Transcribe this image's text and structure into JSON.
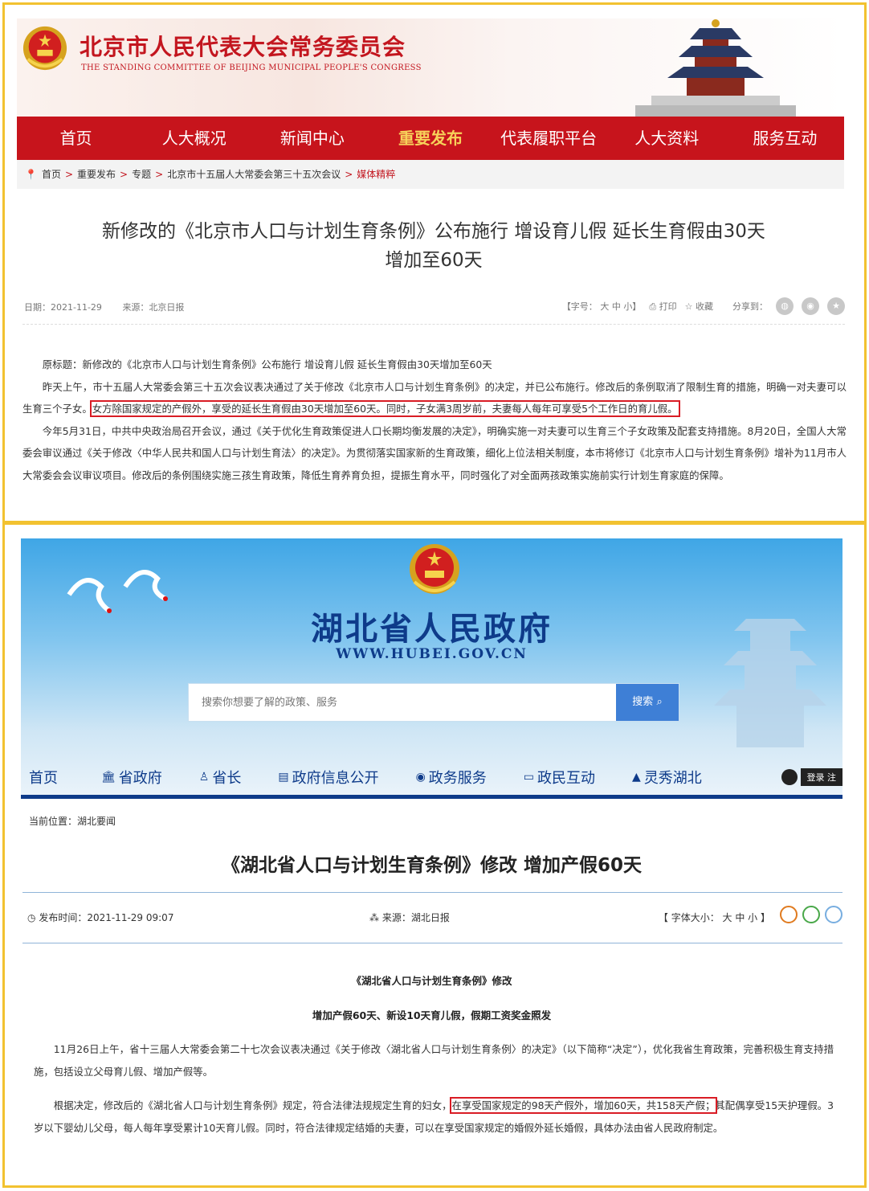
{
  "beijing": {
    "site_title": "北京市人民代表大会常务委员会",
    "site_subtitle": "THE STANDING COMMITTEE OF BEIJING MUNICIPAL PEOPLE'S CONGRESS",
    "nav": [
      "首页",
      "人大概况",
      "新闻中心",
      "重要发布",
      "代表履职平台",
      "人大资料",
      "服务互动"
    ],
    "nav_active": "重要发布",
    "breadcrumb": [
      "首页",
      "重要发布",
      "专题",
      "北京市十五届人大常委会第三十五次会议",
      "媒体精粹"
    ],
    "headline_line1": "新修改的《北京市人口与计划生育条例》公布施行 增设育儿假 延长生育假由30天",
    "headline_line2": "增加至60天",
    "date": "日期：2021-11-29",
    "source": "来源：北京日报",
    "font_size_label": "【字号：",
    "font_sizes": [
      "大",
      "中",
      "小】"
    ],
    "print": "打印",
    "favorite": "收藏",
    "share": "分享到：",
    "para1": "原标题：新修改的《北京市人口与计划生育条例》公布施行 增设育儿假 延长生育假由30天增加至60天",
    "para2_a": "昨天上午，市十五届人大常委会第三十五次会议表决通过了关于修改《北京市人口与计划生育条例》的决定，并已公布施行。修改后的条例取消了限制生育的措施，明确一对夫妻可以生育三个子女。",
    "para2_hl": "女方除国家规定的产假外，享受的延长生育假由30天增加至60天。同时，子女满3周岁前，夫妻每人每年可享受5个工作日的育儿假。",
    "para3": "今年5月31日，中共中央政治局召开会议，通过《关于优化生育政策促进人口长期均衡发展的决定》，明确实施一对夫妻可以生育三个子女政策及配套支持措施。8月20日，全国人大常委会审议通过《关于修改〈中华人民共和国人口与计划生育法〉的决定》。为贯彻落实国家新的生育政策，细化上位法相关制度，本市将修订《北京市人口与计划生育条例》增补为11月市人大常委会会议审议项目。修改后的条例围绕实施三孩生育政策，降低生育养育负担，提振生育水平，同时强化了对全面两孩政策实施前实行计划生育家庭的保障。"
  },
  "hubei": {
    "site_title": "湖北省人民政府",
    "site_url": "WWW.HUBEI.GOV.CN",
    "search_placeholder": "搜索你想要了解的政策、服务",
    "search_button": "搜索",
    "nav": [
      {
        "label": "首页",
        "icon": ""
      },
      {
        "label": "省政府",
        "icon": "🏛"
      },
      {
        "label": "省长",
        "icon": "♙"
      },
      {
        "label": "政府信息公开",
        "icon": "▤"
      },
      {
        "label": "政务服务",
        "icon": "◉"
      },
      {
        "label": "政民互动",
        "icon": "▭"
      },
      {
        "label": "灵秀湖北",
        "icon": "▲"
      }
    ],
    "login": "登录 注",
    "breadcrumb": "当前位置：湖北要闻",
    "headline": "《湖北省人口与计划生育条例》修改 增加产假60天",
    "publish_time": "发布时间：2021-11-29 09:07",
    "source": "来源：湖北日报",
    "font_size_label": "【 字体大小：",
    "font_sizes": "大 中 小 】",
    "sub1": "《湖北省人口与计划生育条例》修改",
    "sub2": "增加产假60天、新设10天育儿假，假期工资奖金照发",
    "para1": "11月26日上午，省十三届人大常委会第二十七次会议表决通过《关于修改〈湖北省人口与计划生育条例〉的决定》（以下简称“决定”），优化我省生育政策，完善积极生育支持措施，包括设立父母育儿假、增加产假等。",
    "para2_a": "根据决定，修改后的《湖北省人口与计划生育条例》规定，符合法律法规规定生育的妇女，",
    "para2_hl": "在享受国家规定的98天产假外，增加60天，共158天产假；",
    "para2_b": "其配偶享受15天护理假。3岁以下婴幼儿父母，每人每年享受累计10天育儿假。同时，符合法律规定结婚的夫妻，可以在享受国家规定的婚假外延长婚假，具体办法由省人民政府制定。"
  },
  "colors": {
    "beijing_red": "#c7141c",
    "hubei_blue": "#0e3b8a",
    "frame_yellow": "#f2c230",
    "highlight_red": "#d91c25"
  }
}
